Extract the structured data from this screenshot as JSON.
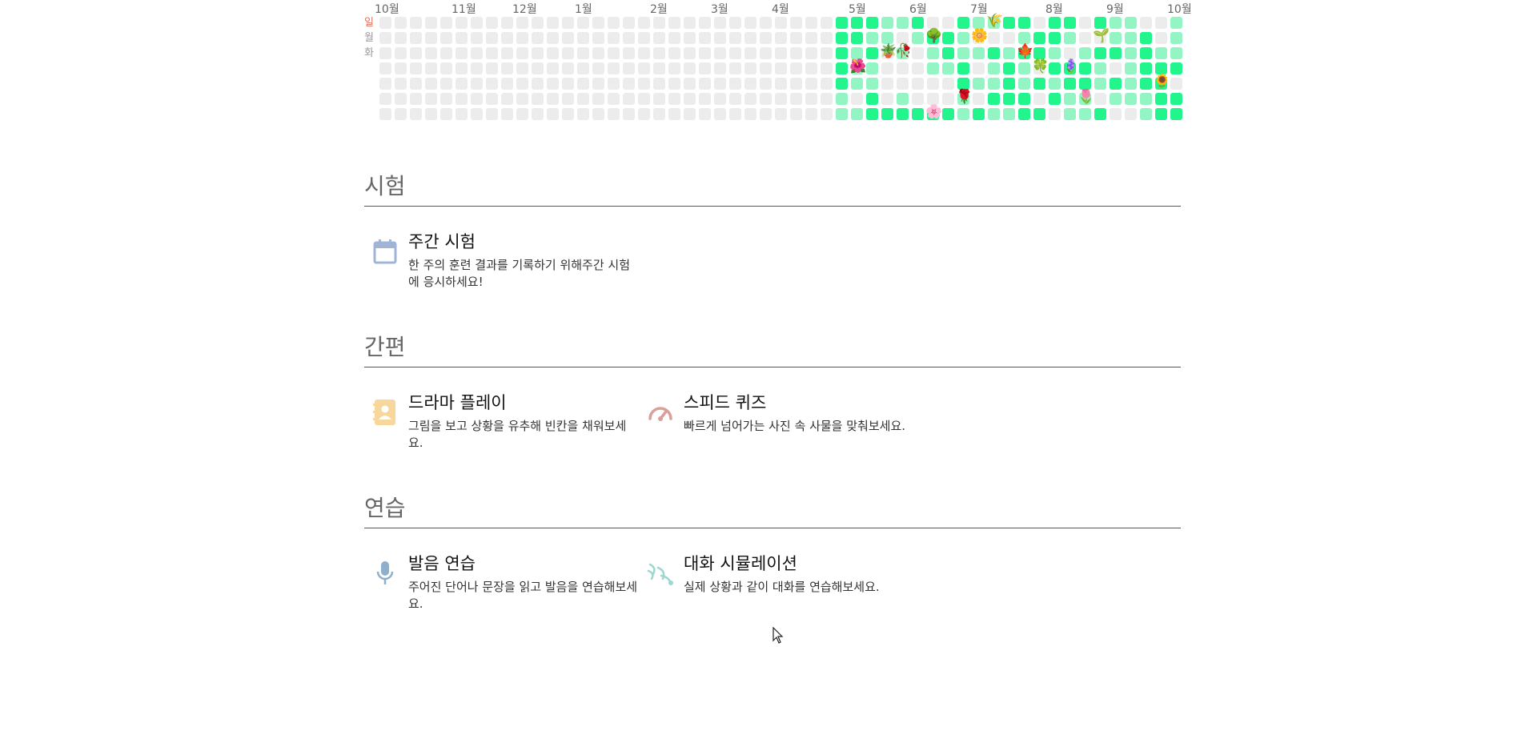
{
  "heatmap": {
    "months": [
      "10월",
      "11월",
      "12월",
      "1월",
      "2월",
      "3월",
      "4월",
      "5월",
      "6월",
      "7월",
      "8월",
      "9월",
      "10월"
    ],
    "day_labels": [
      "일",
      "월",
      "화"
    ],
    "cols": 53,
    "rows": 7,
    "emojis": [
      "🌾",
      "🌱",
      "🌳",
      "🌼",
      "🪴",
      "🥀",
      "🍁",
      "🌺",
      "🍀",
      "🪻",
      "🌻",
      "🌹",
      "🌷",
      "🌸"
    ]
  },
  "sections": {
    "exam": {
      "title": "시험",
      "cards": [
        {
          "title": "주간 시험",
          "desc": "한 주의 훈련 결과를 기록하기 위해주간 시험에 응시하세요!",
          "icon": "calendar-icon",
          "color": "#9fb4d6"
        }
      ]
    },
    "quick": {
      "title": "간편",
      "cards": [
        {
          "title": "드라마 플레이",
          "desc": "그림을 보고 상황을 유추해 빈칸을 채워보세요.",
          "icon": "contact-book-icon",
          "color": "#f7d79b"
        },
        {
          "title": "스피드 퀴즈",
          "desc": "빠르게 넘어가는 사진 속 사물을 맞춰보세요.",
          "icon": "speedometer-icon",
          "color": "#d9a09a"
        }
      ]
    },
    "practice": {
      "title": "연습",
      "cards": [
        {
          "title": "발음 연습",
          "desc": "주어진 단어나 문장을 읽고 발음을 연습해보세요.",
          "icon": "microphone-icon",
          "color": "#8fb0cc"
        },
        {
          "title": "대화 시뮬레이션",
          "desc": "실제 상황과 같이 대화를 연습해보세요.",
          "icon": "conversation-waves-icon",
          "color": "#9ed6d2"
        }
      ]
    }
  }
}
